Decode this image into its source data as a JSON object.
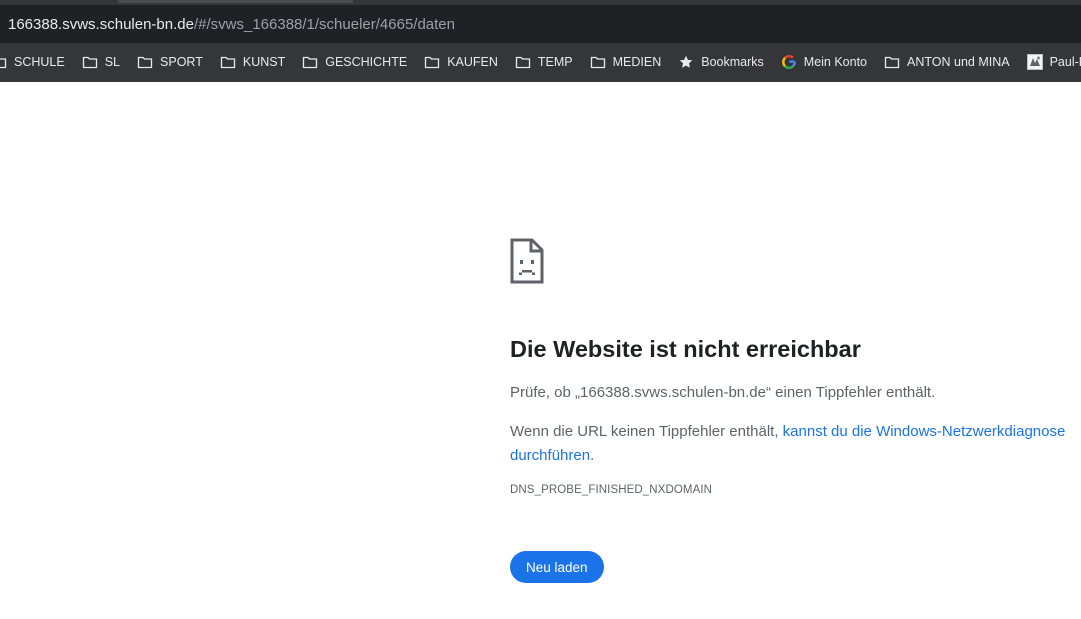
{
  "omnibox": {
    "host": "166388.svws.schulen-bn.de",
    "path": "/#/svws_166388/1/schueler/4665/daten"
  },
  "bookmarks": [
    {
      "label": "SCHULE",
      "icon": "folder-icon"
    },
    {
      "label": "SL",
      "icon": "folder-icon"
    },
    {
      "label": "SPORT",
      "icon": "folder-icon"
    },
    {
      "label": "KUNST",
      "icon": "folder-icon"
    },
    {
      "label": "GESCHICHTE",
      "icon": "folder-icon"
    },
    {
      "label": "KAUFEN",
      "icon": "folder-icon"
    },
    {
      "label": "TEMP",
      "icon": "folder-icon"
    },
    {
      "label": "MEDIEN",
      "icon": "folder-icon"
    },
    {
      "label": "Bookmarks",
      "icon": "star-icon"
    },
    {
      "label": "Mein Konto",
      "icon": "google-icon"
    },
    {
      "label": "ANTON und MINA",
      "icon": "folder-icon"
    },
    {
      "label": "Paul-Klee-Gymn",
      "icon": "site-favicon-icon"
    }
  ],
  "error": {
    "title": "Die Website ist nicht erreichbar",
    "check_text": "Prüfe, ob „166388.svws.schulen-bn.de“ einen Tippfehler enthält.",
    "hint_prefix": "Wenn die URL keinen Tippfehler enthält, ",
    "hint_link": "kannst du die Windows-Netzwerkdiagnose durchführen",
    "hint_suffix": ".",
    "code": "DNS_PROBE_FINISHED_NXDOMAIN",
    "reload_label": "Neu laden"
  },
  "colors": {
    "toolbar_bg": "#35363a",
    "omnibox_bg": "#202124",
    "link": "#1a73e8",
    "button": "#1a73e8"
  }
}
